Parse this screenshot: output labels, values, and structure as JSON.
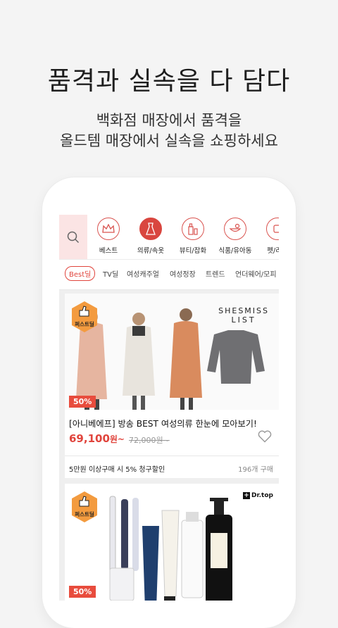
{
  "headline": "품격과 실속을 다 담다",
  "sub_line1": "백화점 매장에서 품격을",
  "sub_line2": "올드템 매장에서 실속을 쇼핑하세요",
  "categories": [
    {
      "label": "베스트",
      "icon": "crown-icon"
    },
    {
      "label": "의류/속옷",
      "icon": "dress-icon"
    },
    {
      "label": "뷰티/잡화",
      "icon": "cosmetics-icon"
    },
    {
      "label": "식품/유아동",
      "icon": "baby-bottle-icon"
    },
    {
      "label": "펫/리빙",
      "icon": "pet-icon"
    }
  ],
  "tabs": [
    "Best딜",
    "TV딜",
    "여성캐주얼",
    "여성정장",
    "트렌드",
    "언더웨어/모피"
  ],
  "product1": {
    "badge": "퍼스트딜",
    "brand_line1": "SHESMISS",
    "brand_line2": "LIST",
    "discount": "50%",
    "title": "[아니베에프] 방송 BEST 여성의류 한눈에 모아보기!",
    "price": "69,100",
    "price_unit": "원~",
    "original_price": "72,000원~",
    "promo": "5만원 이상구매 시 5% 청구할인",
    "purchase_count": "196개 구매"
  },
  "product2": {
    "badge": "퍼스트딜",
    "brand": "Dr.top",
    "discount": "50%"
  },
  "colors": {
    "accent": "#e0443c",
    "badge": "#f39b3f"
  }
}
